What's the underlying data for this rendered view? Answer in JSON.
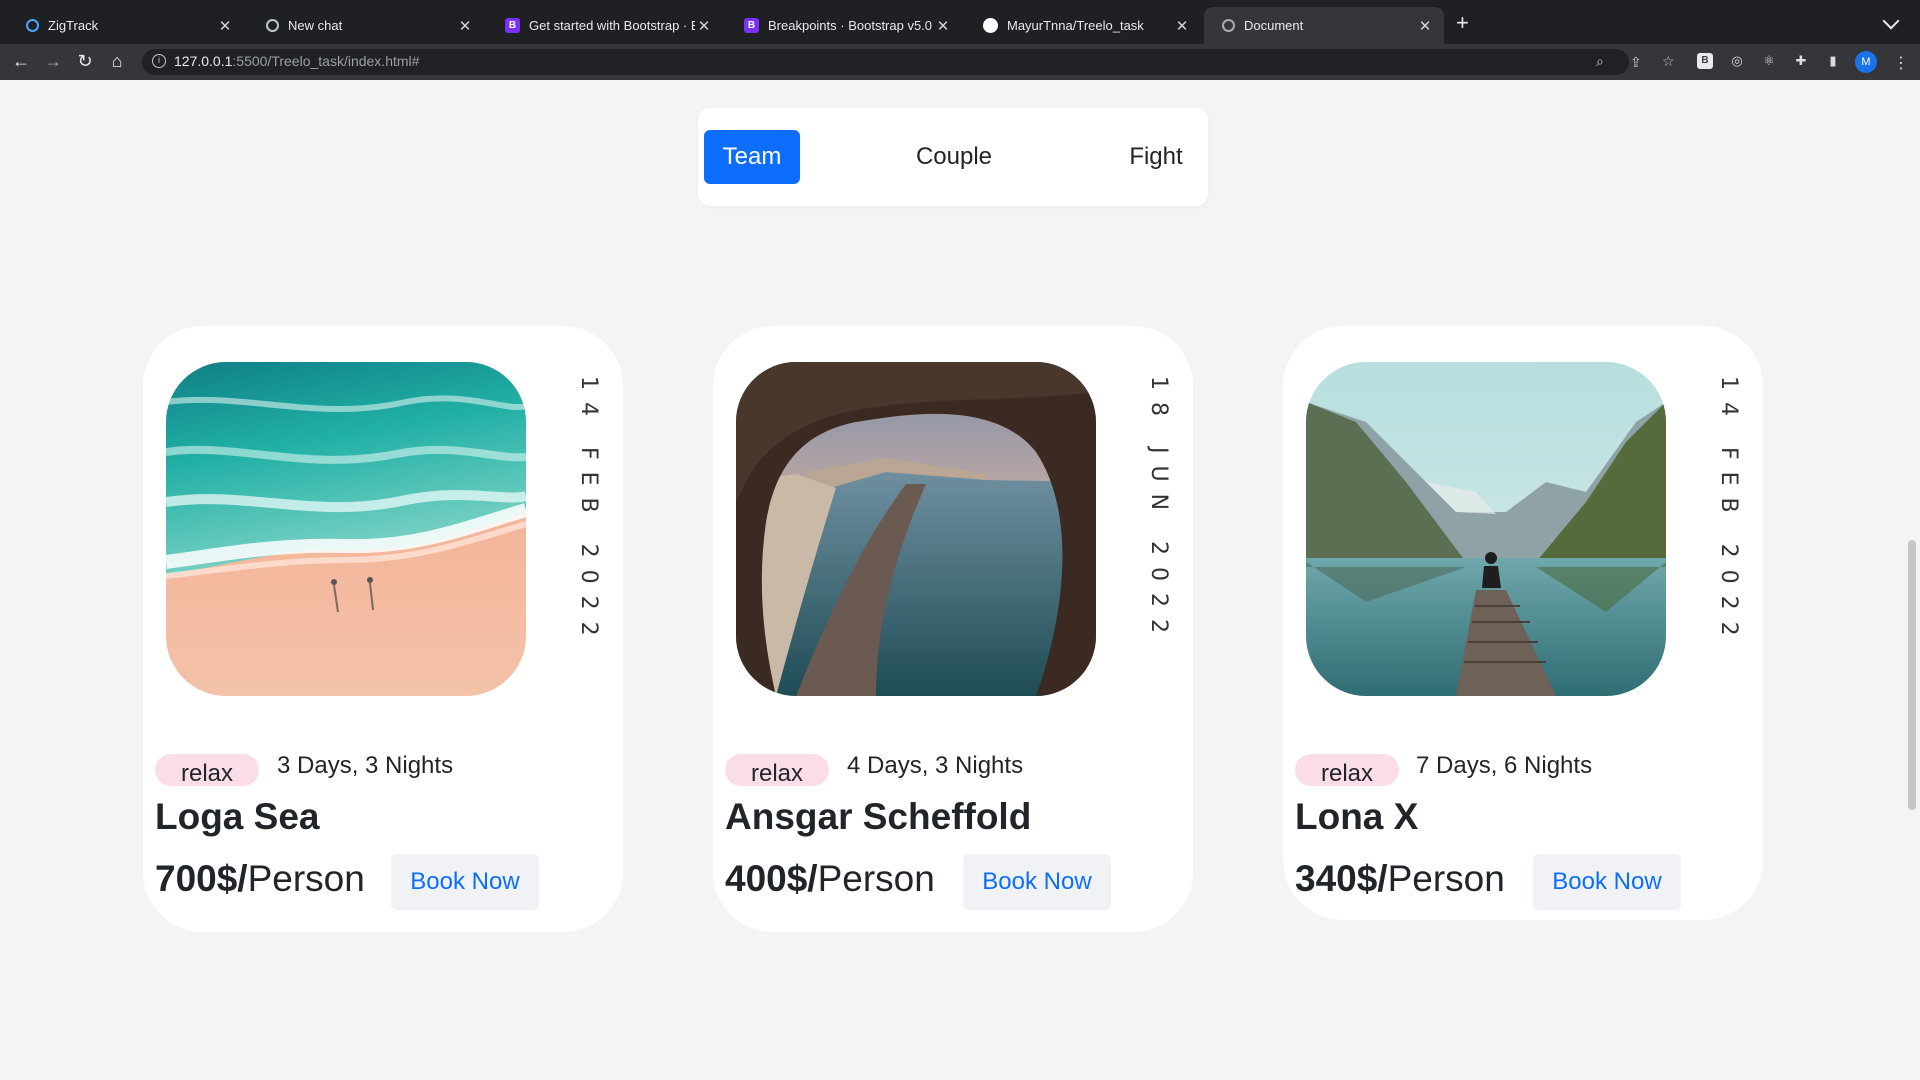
{
  "browser": {
    "tabs": [
      {
        "title": "ZigTrack",
        "icon": "zigtrack-icon"
      },
      {
        "title": "New chat",
        "icon": "chatgpt-icon"
      },
      {
        "title": "Get started with Bootstrap · Bo",
        "icon": "bootstrap-icon"
      },
      {
        "title": "Breakpoints · Bootstrap v5.0",
        "icon": "bootstrap-icon"
      },
      {
        "title": "MayurTnna/Treelo_task",
        "icon": "github-icon"
      },
      {
        "title": "Document",
        "icon": "globe-icon",
        "active": true
      }
    ],
    "url_host": "127.0.0.1",
    "url_rest": ":5500/Treelo_task/index.html#",
    "profile_initial": "M",
    "bootstrap_glyph": "B",
    "zoom_glyph": "⌕"
  },
  "filter": {
    "items": [
      "Team",
      "Couple",
      "Fight"
    ],
    "active": "Team",
    "active_color": "#0d6efd"
  },
  "cards": [
    {
      "date": "14 FEB 2022",
      "tag": "relax",
      "duration": "3 Days, 3 Nights",
      "name": "Loga Sea",
      "price": "700$/",
      "unit": "Person",
      "button": "Book Now",
      "image": "beach-aerial"
    },
    {
      "date": "18 JUN 2022",
      "tag": "relax",
      "duration": "4 Days, 3 Nights",
      "name": "Ansgar Scheffold",
      "price": "400$/",
      "unit": "Person",
      "button": "Book Now",
      "image": "cave-coastline"
    },
    {
      "date": "14 FEB 2022",
      "tag": "relax",
      "duration": "7 Days, 6 Nights",
      "name": "Lona X",
      "price": "340$/",
      "unit": "Person",
      "button": "Book Now",
      "image": "lake-pier"
    }
  ],
  "colors": {
    "tag_bg": "#fbdde9",
    "button_text": "#0d6efd",
    "page_bg": "#f4f4f4"
  }
}
